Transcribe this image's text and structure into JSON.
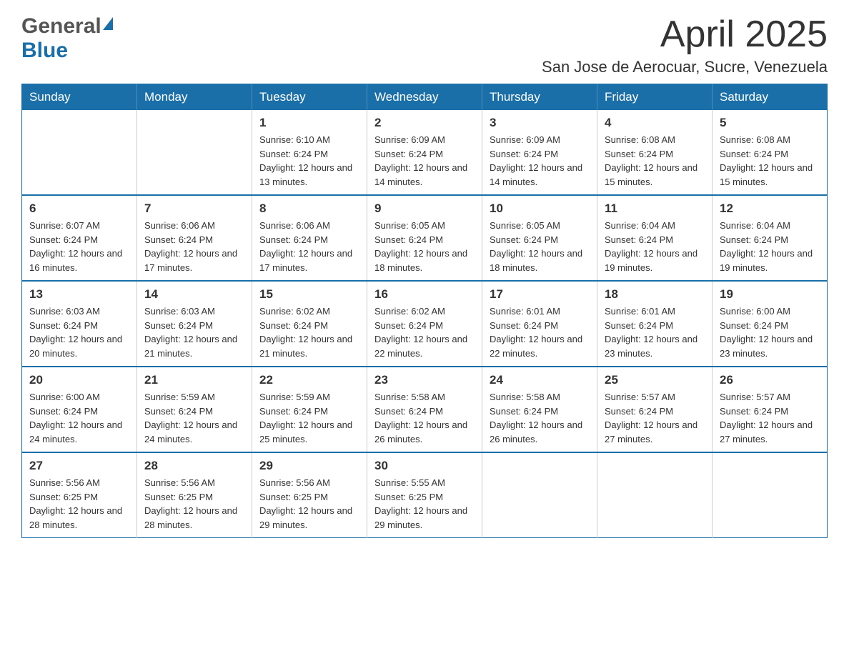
{
  "header": {
    "logo_general": "General",
    "logo_blue": "Blue",
    "month_title": "April 2025",
    "location": "San Jose de Aerocuar, Sucre, Venezuela"
  },
  "days_of_week": [
    "Sunday",
    "Monday",
    "Tuesday",
    "Wednesday",
    "Thursday",
    "Friday",
    "Saturday"
  ],
  "weeks": [
    {
      "days": [
        {
          "number": "",
          "sunrise": "",
          "sunset": "",
          "daylight": ""
        },
        {
          "number": "",
          "sunrise": "",
          "sunset": "",
          "daylight": ""
        },
        {
          "number": "1",
          "sunrise": "Sunrise: 6:10 AM",
          "sunset": "Sunset: 6:24 PM",
          "daylight": "Daylight: 12 hours and 13 minutes."
        },
        {
          "number": "2",
          "sunrise": "Sunrise: 6:09 AM",
          "sunset": "Sunset: 6:24 PM",
          "daylight": "Daylight: 12 hours and 14 minutes."
        },
        {
          "number": "3",
          "sunrise": "Sunrise: 6:09 AM",
          "sunset": "Sunset: 6:24 PM",
          "daylight": "Daylight: 12 hours and 14 minutes."
        },
        {
          "number": "4",
          "sunrise": "Sunrise: 6:08 AM",
          "sunset": "Sunset: 6:24 PM",
          "daylight": "Daylight: 12 hours and 15 minutes."
        },
        {
          "number": "5",
          "sunrise": "Sunrise: 6:08 AM",
          "sunset": "Sunset: 6:24 PM",
          "daylight": "Daylight: 12 hours and 15 minutes."
        }
      ]
    },
    {
      "days": [
        {
          "number": "6",
          "sunrise": "Sunrise: 6:07 AM",
          "sunset": "Sunset: 6:24 PM",
          "daylight": "Daylight: 12 hours and 16 minutes."
        },
        {
          "number": "7",
          "sunrise": "Sunrise: 6:06 AM",
          "sunset": "Sunset: 6:24 PM",
          "daylight": "Daylight: 12 hours and 17 minutes."
        },
        {
          "number": "8",
          "sunrise": "Sunrise: 6:06 AM",
          "sunset": "Sunset: 6:24 PM",
          "daylight": "Daylight: 12 hours and 17 minutes."
        },
        {
          "number": "9",
          "sunrise": "Sunrise: 6:05 AM",
          "sunset": "Sunset: 6:24 PM",
          "daylight": "Daylight: 12 hours and 18 minutes."
        },
        {
          "number": "10",
          "sunrise": "Sunrise: 6:05 AM",
          "sunset": "Sunset: 6:24 PM",
          "daylight": "Daylight: 12 hours and 18 minutes."
        },
        {
          "number": "11",
          "sunrise": "Sunrise: 6:04 AM",
          "sunset": "Sunset: 6:24 PM",
          "daylight": "Daylight: 12 hours and 19 minutes."
        },
        {
          "number": "12",
          "sunrise": "Sunrise: 6:04 AM",
          "sunset": "Sunset: 6:24 PM",
          "daylight": "Daylight: 12 hours and 19 minutes."
        }
      ]
    },
    {
      "days": [
        {
          "number": "13",
          "sunrise": "Sunrise: 6:03 AM",
          "sunset": "Sunset: 6:24 PM",
          "daylight": "Daylight: 12 hours and 20 minutes."
        },
        {
          "number": "14",
          "sunrise": "Sunrise: 6:03 AM",
          "sunset": "Sunset: 6:24 PM",
          "daylight": "Daylight: 12 hours and 21 minutes."
        },
        {
          "number": "15",
          "sunrise": "Sunrise: 6:02 AM",
          "sunset": "Sunset: 6:24 PM",
          "daylight": "Daylight: 12 hours and 21 minutes."
        },
        {
          "number": "16",
          "sunrise": "Sunrise: 6:02 AM",
          "sunset": "Sunset: 6:24 PM",
          "daylight": "Daylight: 12 hours and 22 minutes."
        },
        {
          "number": "17",
          "sunrise": "Sunrise: 6:01 AM",
          "sunset": "Sunset: 6:24 PM",
          "daylight": "Daylight: 12 hours and 22 minutes."
        },
        {
          "number": "18",
          "sunrise": "Sunrise: 6:01 AM",
          "sunset": "Sunset: 6:24 PM",
          "daylight": "Daylight: 12 hours and 23 minutes."
        },
        {
          "number": "19",
          "sunrise": "Sunrise: 6:00 AM",
          "sunset": "Sunset: 6:24 PM",
          "daylight": "Daylight: 12 hours and 23 minutes."
        }
      ]
    },
    {
      "days": [
        {
          "number": "20",
          "sunrise": "Sunrise: 6:00 AM",
          "sunset": "Sunset: 6:24 PM",
          "daylight": "Daylight: 12 hours and 24 minutes."
        },
        {
          "number": "21",
          "sunrise": "Sunrise: 5:59 AM",
          "sunset": "Sunset: 6:24 PM",
          "daylight": "Daylight: 12 hours and 24 minutes."
        },
        {
          "number": "22",
          "sunrise": "Sunrise: 5:59 AM",
          "sunset": "Sunset: 6:24 PM",
          "daylight": "Daylight: 12 hours and 25 minutes."
        },
        {
          "number": "23",
          "sunrise": "Sunrise: 5:58 AM",
          "sunset": "Sunset: 6:24 PM",
          "daylight": "Daylight: 12 hours and 26 minutes."
        },
        {
          "number": "24",
          "sunrise": "Sunrise: 5:58 AM",
          "sunset": "Sunset: 6:24 PM",
          "daylight": "Daylight: 12 hours and 26 minutes."
        },
        {
          "number": "25",
          "sunrise": "Sunrise: 5:57 AM",
          "sunset": "Sunset: 6:24 PM",
          "daylight": "Daylight: 12 hours and 27 minutes."
        },
        {
          "number": "26",
          "sunrise": "Sunrise: 5:57 AM",
          "sunset": "Sunset: 6:24 PM",
          "daylight": "Daylight: 12 hours and 27 minutes."
        }
      ]
    },
    {
      "days": [
        {
          "number": "27",
          "sunrise": "Sunrise: 5:56 AM",
          "sunset": "Sunset: 6:25 PM",
          "daylight": "Daylight: 12 hours and 28 minutes."
        },
        {
          "number": "28",
          "sunrise": "Sunrise: 5:56 AM",
          "sunset": "Sunset: 6:25 PM",
          "daylight": "Daylight: 12 hours and 28 minutes."
        },
        {
          "number": "29",
          "sunrise": "Sunrise: 5:56 AM",
          "sunset": "Sunset: 6:25 PM",
          "daylight": "Daylight: 12 hours and 29 minutes."
        },
        {
          "number": "30",
          "sunrise": "Sunrise: 5:55 AM",
          "sunset": "Sunset: 6:25 PM",
          "daylight": "Daylight: 12 hours and 29 minutes."
        },
        {
          "number": "",
          "sunrise": "",
          "sunset": "",
          "daylight": ""
        },
        {
          "number": "",
          "sunrise": "",
          "sunset": "",
          "daylight": ""
        },
        {
          "number": "",
          "sunrise": "",
          "sunset": "",
          "daylight": ""
        }
      ]
    }
  ],
  "colors": {
    "header_bg": "#1a6fa8",
    "border": "#1a6fa8"
  }
}
